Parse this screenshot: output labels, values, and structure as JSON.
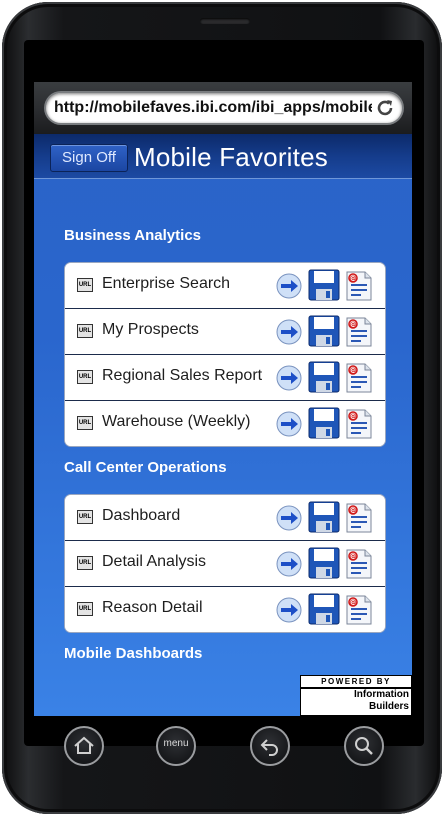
{
  "browser": {
    "url": "http://mobilefaves.ibi.com/ibi_apps/mobile"
  },
  "header": {
    "sign_off_label": "Sign Off",
    "title": "Mobile Favorites"
  },
  "sections": [
    {
      "title": "Business Analytics",
      "items": [
        {
          "label": "Enterprise Search"
        },
        {
          "label": "My Prospects"
        },
        {
          "label": "Regional Sales Report"
        },
        {
          "label": "Warehouse (Weekly)"
        }
      ]
    },
    {
      "title": "Call Center Operations",
      "items": [
        {
          "label": "Dashboard"
        },
        {
          "label": "Detail Analysis"
        },
        {
          "label": "Reason Detail"
        }
      ]
    },
    {
      "title": "Mobile Dashboards",
      "items": []
    }
  ],
  "item_icon_text": "URL",
  "powered_by": {
    "top": "POWERED BY",
    "line1": "Information",
    "line2": "Builders"
  },
  "nav": {
    "menu_label": "menu"
  },
  "colors": {
    "background_blue": "#2a66cd",
    "title_bar": "#153c8b",
    "go_arrow": "#1d4fc7"
  },
  "icons": [
    "reload-icon",
    "url-icon",
    "go-arrow-icon",
    "save-icon",
    "email-icon",
    "home-icon",
    "back-icon",
    "search-icon"
  ]
}
